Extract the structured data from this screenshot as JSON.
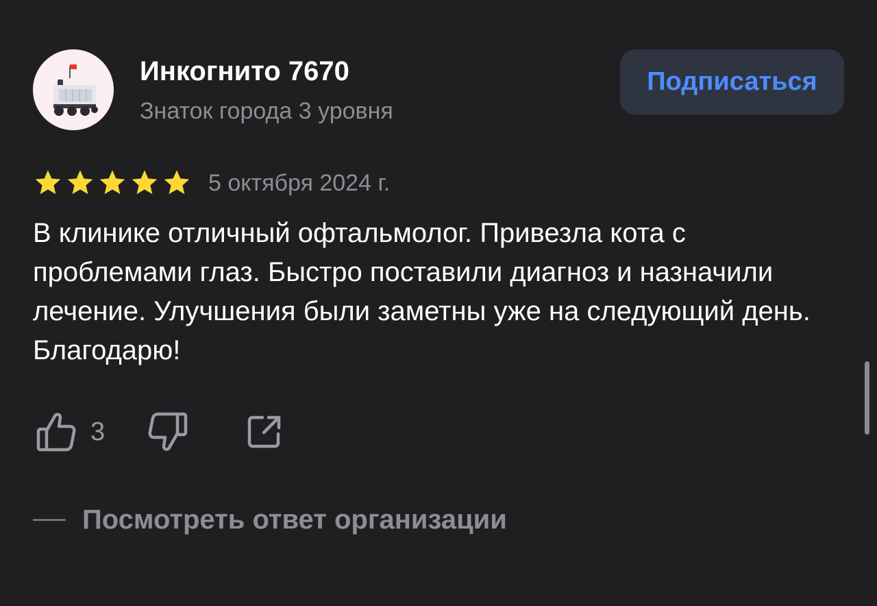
{
  "user": {
    "name": "Инкогнито 7670",
    "level": "Знаток города 3 уровня",
    "avatar_icon": "delivery-robot-icon"
  },
  "subscribe": {
    "label": "Подписаться"
  },
  "review": {
    "rating": 5,
    "rating_max": 5,
    "date": "5 октября 2024 г.",
    "text": "В клинике отличный офтальмолог. Привезла кота с проблемами глаз. Быстро поставили диагноз и назначили лечение. Улучшения были заметны уже на следующий день. Благодарю!"
  },
  "actions": {
    "like_count": "3",
    "like_icon": "thumbs-up-icon",
    "dislike_icon": "thumbs-down-icon",
    "share_icon": "share-icon"
  },
  "org_reply": {
    "label": "Посмотреть ответ организации"
  },
  "colors": {
    "background": "#1f1f21",
    "accent": "#4d8cff",
    "star": "#fdd835",
    "muted_text": "#8d8d92"
  }
}
